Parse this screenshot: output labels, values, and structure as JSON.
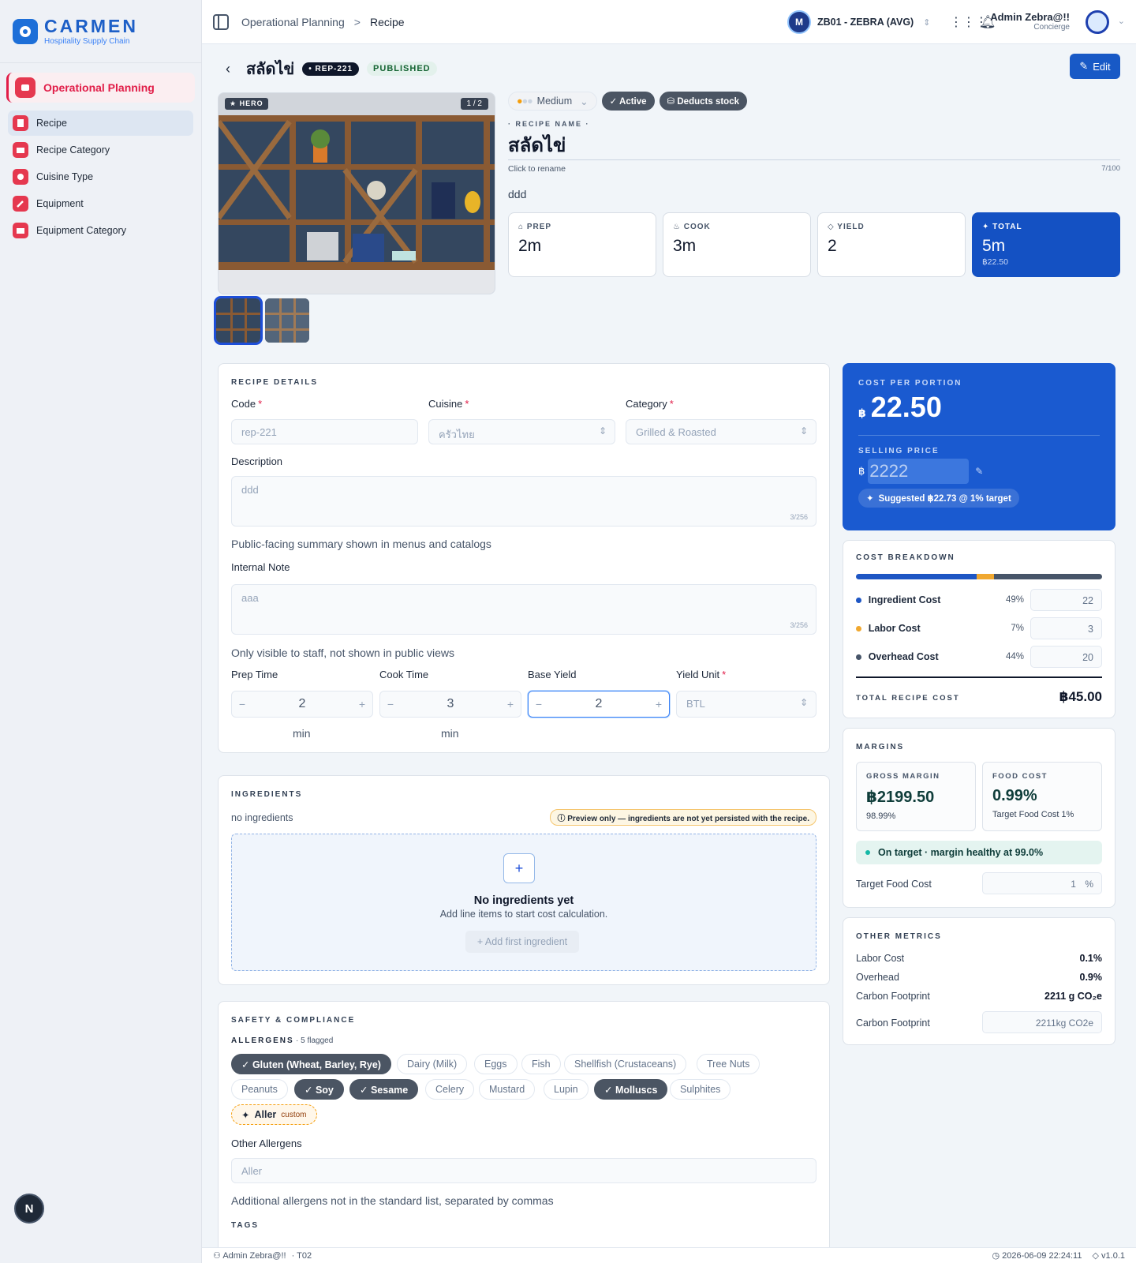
{
  "brand": {
    "name": "CARMEN",
    "sub": "Hospitality Supply Chain"
  },
  "sidebar": {
    "section": "Operational Planning",
    "items": [
      {
        "label": "Recipe",
        "icon": "book-icon",
        "active": true
      },
      {
        "label": "Recipe Category",
        "icon": "folder-icon"
      },
      {
        "label": "Cuisine Type",
        "icon": "chef-icon"
      },
      {
        "label": "Equipment",
        "icon": "wrench-icon"
      },
      {
        "label": "Equipment Category",
        "icon": "folder-icon"
      }
    ],
    "badge": "N"
  },
  "topbar": {
    "breadcrumb": [
      "Operational Planning",
      "Recipe"
    ],
    "separator": ">",
    "tenant": "ZB01 - ZEBRA (AVG)",
    "tenant_logo": "M",
    "user_name": "Admin Zebra@!!",
    "user_role": "Concierge"
  },
  "header": {
    "title": "สลัดไข่",
    "code_badge": "• REP-221",
    "status": "PUBLISHED",
    "edit_label": "Edit"
  },
  "gallery": {
    "hero_tag": "★ HERO",
    "count": "1 / 2"
  },
  "meta": {
    "difficulty": "Medium",
    "active_label": "✓ Active",
    "stock_label": "⛁ Deducts stock",
    "recipe_name_label": "· RECIPE NAME ·",
    "recipe_name": "สลัดไข่",
    "rename_hint": "Click to rename",
    "name_count": "7/100",
    "description": "ddd"
  },
  "stats": {
    "prep_label": "PREP",
    "prep_value": "2m",
    "cook_label": "COOK",
    "cook_value": "3m",
    "yield_label": "YIELD",
    "yield_value": "2",
    "total_label": "TOTAL",
    "total_value": "5m",
    "total_cost": "฿22.50"
  },
  "details": {
    "title": "RECIPE DETAILS",
    "code_label": "Code",
    "code_value": "rep-221",
    "cuisine_label": "Cuisine",
    "cuisine_value": "ครัวไทย",
    "category_label": "Category",
    "category_value": "Grilled & Roasted",
    "description_label": "Description",
    "description_value": "ddd",
    "description_count": "3/256",
    "description_hint": "Public-facing summary shown in menus and catalogs",
    "note_label": "Internal Note",
    "note_value": "aaa",
    "note_count": "3/256",
    "note_hint": "Only visible to staff, not shown in public views",
    "prep_label": "Prep Time",
    "prep_value": "2",
    "prep_unit": "min",
    "cook_label": "Cook Time",
    "cook_value": "3",
    "cook_unit": "min",
    "yield_label": "Base Yield",
    "yield_value": "2",
    "yield_unit_label": "Yield Unit",
    "yield_unit_value": "BTL",
    "minus": "−",
    "plus": "+"
  },
  "ingredients": {
    "title": "INGREDIENTS",
    "status": "no ingredients",
    "preview_note": "ⓘ Preview only — ingredients are not yet persisted with the recipe.",
    "empty_title": "No ingredients yet",
    "empty_sub": "Add line items to start cost calculation.",
    "add_label": "+ Add first ingredient"
  },
  "safety": {
    "title": "SAFETY & COMPLIANCE",
    "allergens_label": "ALLERGENS",
    "flagged": "· 5 flagged",
    "allergens": [
      {
        "label": "✓ Gluten (Wheat, Barley, Rye)",
        "on": true
      },
      {
        "label": "Dairy (Milk)",
        "on": false
      },
      {
        "label": "Eggs",
        "on": false
      },
      {
        "label": "Fish",
        "on": false
      },
      {
        "label": "Shellfish (Crustaceans)",
        "on": false
      },
      {
        "label": "Tree Nuts",
        "on": false
      },
      {
        "label": "Peanuts",
        "on": false
      },
      {
        "label": "✓ Soy",
        "on": true
      },
      {
        "label": "✓ Sesame",
        "on": true
      },
      {
        "label": "Celery",
        "on": false
      },
      {
        "label": "Mustard",
        "on": false
      },
      {
        "label": "Lupin",
        "on": false
      },
      {
        "label": "✓ Molluscs",
        "on": true
      },
      {
        "label": "Sulphites",
        "on": false
      }
    ],
    "custom_chip": "Aller",
    "custom_tag": "custom",
    "other_label": "Other Allergens",
    "other_value": "Aller",
    "other_hint": "Additional allergens not in the standard list, separated by commas",
    "tags_label": "TAGS"
  },
  "cost": {
    "per_portion_label": "COST PER PORTION",
    "currency": "฿",
    "per_portion": "22.50",
    "selling_label": "SELLING PRICE",
    "selling_value": "2222",
    "suggest": "Suggested ฿22.73 @ 1% target"
  },
  "breakdown": {
    "title": "COST BREAKDOWN",
    "rows": [
      {
        "name": "Ingredient Cost",
        "pct": "49%",
        "value": "22",
        "color": "#1e56c4"
      },
      {
        "name": "Labor Cost",
        "pct": "7%",
        "value": "3",
        "color": "#f0a830"
      },
      {
        "name": "Overhead Cost",
        "pct": "44%",
        "value": "20",
        "color": "#475569"
      }
    ],
    "total_label": "TOTAL RECIPE COST",
    "total_value": "฿45.00"
  },
  "margins": {
    "title": "MARGINS",
    "gross_label": "GROSS MARGIN",
    "gross_value": "฿2199.50",
    "gross_sub": "98.99%",
    "food_label": "FOOD COST",
    "food_value": "0.99%",
    "food_sub": "Target Food Cost 1%",
    "status": "On target · margin healthy at 99.0%",
    "target_label": "Target Food Cost",
    "target_value": "1",
    "target_unit": "%"
  },
  "metrics": {
    "title": "OTHER METRICS",
    "rows": [
      {
        "label": "Labor Cost",
        "value": "0.1%"
      },
      {
        "label": "Overhead",
        "value": "0.9%"
      },
      {
        "label": "Carbon Footprint",
        "value": "2211 g CO₂e"
      }
    ],
    "carbon_label": "Carbon Footprint",
    "carbon_value": "2211",
    "carbon_unit": "kg CO2e"
  },
  "footer": {
    "user": "Admin Zebra@!!",
    "tenant": "· T02",
    "datetime": "2026-06-09 22:24:11",
    "version": "v1.0.1"
  }
}
